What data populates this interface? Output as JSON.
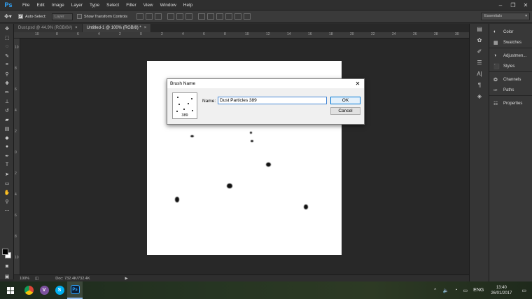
{
  "app": {
    "logo": "Ps",
    "menu": [
      "File",
      "Edit",
      "Image",
      "Layer",
      "Type",
      "Select",
      "Filter",
      "View",
      "Window",
      "Help"
    ],
    "window_controls": [
      "minimize-icon",
      "restore-icon",
      "close-icon"
    ]
  },
  "options": {
    "auto_select_label": "Auto-Select:",
    "auto_select_value": "Layer",
    "transform_label": "Show Transform Controls",
    "workspace": "Essentials"
  },
  "tabs": [
    {
      "label": "Dust.psd @ 44.9% (RGB/8#)",
      "active": false
    },
    {
      "label": "Untitled-1 @ 100% (RGB/8) *",
      "active": true
    }
  ],
  "ruler_ticks": [
    "10",
    "8",
    "6",
    "4",
    "2",
    "0",
    "2",
    "4",
    "6",
    "8",
    "10",
    "12",
    "14",
    "16",
    "18",
    "20",
    "22",
    "24",
    "26",
    "28",
    "30"
  ],
  "status": {
    "zoom": "100%",
    "doc": "Doc: 732.4K/732.4K"
  },
  "panels": {
    "items": [
      {
        "icon": "color-icon",
        "label": "Color"
      },
      {
        "icon": "swatches-icon",
        "label": "Swatches"
      },
      {
        "icon": "adjustments-icon",
        "label": "Adjustmen..."
      },
      {
        "icon": "styles-icon",
        "label": "Styles"
      },
      {
        "icon": "channels-icon",
        "label": "Channels"
      },
      {
        "icon": "paths-icon",
        "label": "Paths"
      },
      {
        "icon": "properties-icon",
        "label": "Properties"
      }
    ]
  },
  "dialog": {
    "title": "Brush Name",
    "brush_size": "389",
    "name_label": "Name:",
    "name_value": "Dust Particles 389",
    "ok": "OK",
    "cancel": "Cancel"
  },
  "taskbar": {
    "apps": [
      {
        "name": "chrome",
        "badge": "",
        "color": "#e8b12c",
        "active": false
      },
      {
        "name": "viber",
        "badge": "V",
        "color": "#7b519d",
        "active": false
      },
      {
        "name": "skype",
        "badge": "S",
        "color": "#00aff0",
        "active": false
      },
      {
        "name": "photoshop",
        "badge": "Ps",
        "color": "#0d1f36",
        "active": true
      }
    ],
    "language": "ENG",
    "time": "13:40",
    "date": "26/01/2017"
  }
}
